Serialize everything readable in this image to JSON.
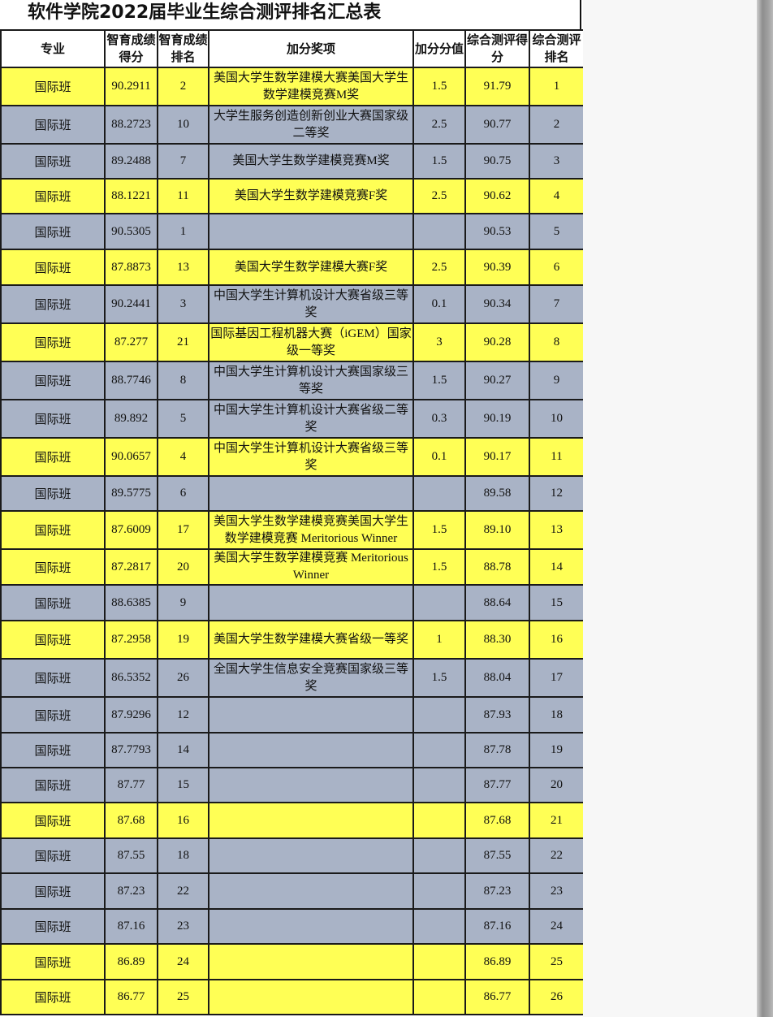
{
  "title": "软件学院2022届毕业生综合测评排名汇总表",
  "headers": {
    "major": "专业",
    "score": "智育成绩得分",
    "score_rank": "智育成绩排名",
    "award": "加分奖项",
    "bonus": "加分分值",
    "total": "综合测评得分",
    "total_rank": "综合测评排名"
  },
  "colors": {
    "yellow_row": "#ffff55",
    "gray_row": "#a9b3c6",
    "grid": "#1a1a1a"
  },
  "rows": [
    {
      "major": "国际班",
      "score": "90.2911",
      "score_rank": "2",
      "award": "美国大学生数学建模大赛美国大学生数学建模竞赛M奖",
      "bonus": "1.5",
      "total": "91.79",
      "total_rank": "1",
      "color": "yellow"
    },
    {
      "major": "国际班",
      "score": "88.2723",
      "score_rank": "10",
      "award": "大学生服务创造创新创业大赛国家级二等奖",
      "bonus": "2.5",
      "total": "90.77",
      "total_rank": "2",
      "color": "gray"
    },
    {
      "major": "国际班",
      "score": "89.2488",
      "score_rank": "7",
      "award": "美国大学生数学建模竞赛M奖",
      "bonus": "1.5",
      "total": "90.75",
      "total_rank": "3",
      "color": "gray"
    },
    {
      "major": "国际班",
      "score": "88.1221",
      "score_rank": "11",
      "award": "美国大学生数学建模竞赛F奖",
      "bonus": "2.5",
      "total": "90.62",
      "total_rank": "4",
      "color": "yellow"
    },
    {
      "major": "国际班",
      "score": "90.5305",
      "score_rank": "1",
      "award": "",
      "bonus": "",
      "total": "90.53",
      "total_rank": "5",
      "color": "gray"
    },
    {
      "major": "国际班",
      "score": "87.8873",
      "score_rank": "13",
      "award": "美国大学生数学建模大赛F奖",
      "bonus": "2.5",
      "total": "90.39",
      "total_rank": "6",
      "color": "yellow"
    },
    {
      "major": "国际班",
      "score": "90.2441",
      "score_rank": "3",
      "award": "中国大学生计算机设计大赛省级三等奖",
      "bonus": "0.1",
      "total": "90.34",
      "total_rank": "7",
      "color": "gray"
    },
    {
      "major": "国际班",
      "score": "87.277",
      "score_rank": "21",
      "award": "国际基因工程机器大赛（iGEM）国家级一等奖",
      "bonus": "3",
      "total": "90.28",
      "total_rank": "8",
      "color": "yellow"
    },
    {
      "major": "国际班",
      "score": "88.7746",
      "score_rank": "8",
      "award": "中国大学生计算机设计大赛国家级三等奖",
      "bonus": "1.5",
      "total": "90.27",
      "total_rank": "9",
      "color": "gray"
    },
    {
      "major": "国际班",
      "score": "89.892",
      "score_rank": "5",
      "award": "中国大学生计算机设计大赛省级二等奖",
      "bonus": "0.3",
      "total": "90.19",
      "total_rank": "10",
      "color": "gray"
    },
    {
      "major": "国际班",
      "score": "90.0657",
      "score_rank": "4",
      "award": "中国大学生计算机设计大赛省级三等奖",
      "bonus": "0.1",
      "total": "90.17",
      "total_rank": "11",
      "color": "yellow"
    },
    {
      "major": "国际班",
      "score": "89.5775",
      "score_rank": "6",
      "award": "",
      "bonus": "",
      "total": "89.58",
      "total_rank": "12",
      "color": "gray"
    },
    {
      "major": "国际班",
      "score": "87.6009",
      "score_rank": "17",
      "award": "美国大学生数学建模竞赛美国大学生数学建模竞赛 Meritorious Winner",
      "bonus": "1.5",
      "total": "89.10",
      "total_rank": "13",
      "color": "yellow"
    },
    {
      "major": "国际班",
      "score": "87.2817",
      "score_rank": "20",
      "award": "美国大学生数学建模竞赛 Meritorious Winner",
      "bonus": "1.5",
      "total": "88.78",
      "total_rank": "14",
      "color": "yellow"
    },
    {
      "major": "国际班",
      "score": "88.6385",
      "score_rank": "9",
      "award": "",
      "bonus": "",
      "total": "88.64",
      "total_rank": "15",
      "color": "gray"
    },
    {
      "major": "国际班",
      "score": "87.2958",
      "score_rank": "19",
      "award": "美国大学生数学建模大赛省级一等奖",
      "bonus": "1",
      "total": "88.30",
      "total_rank": "16",
      "color": "yellow"
    },
    {
      "major": "国际班",
      "score": "86.5352",
      "score_rank": "26",
      "award": "全国大学生信息安全竞赛国家级三等奖",
      "bonus": "1.5",
      "total": "88.04",
      "total_rank": "17",
      "color": "gray"
    },
    {
      "major": "国际班",
      "score": "87.9296",
      "score_rank": "12",
      "award": "",
      "bonus": "",
      "total": "87.93",
      "total_rank": "18",
      "color": "gray"
    },
    {
      "major": "国际班",
      "score": "87.7793",
      "score_rank": "14",
      "award": "",
      "bonus": "",
      "total": "87.78",
      "total_rank": "19",
      "color": "gray"
    },
    {
      "major": "国际班",
      "score": "87.77",
      "score_rank": "15",
      "award": "",
      "bonus": "",
      "total": "87.77",
      "total_rank": "20",
      "color": "gray"
    },
    {
      "major": "国际班",
      "score": "87.68",
      "score_rank": "16",
      "award": "",
      "bonus": "",
      "total": "87.68",
      "total_rank": "21",
      "color": "yellow"
    },
    {
      "major": "国际班",
      "score": "87.55",
      "score_rank": "18",
      "award": "",
      "bonus": "",
      "total": "87.55",
      "total_rank": "22",
      "color": "gray"
    },
    {
      "major": "国际班",
      "score": "87.23",
      "score_rank": "22",
      "award": "",
      "bonus": "",
      "total": "87.23",
      "total_rank": "23",
      "color": "gray"
    },
    {
      "major": "国际班",
      "score": "87.16",
      "score_rank": "23",
      "award": "",
      "bonus": "",
      "total": "87.16",
      "total_rank": "24",
      "color": "gray"
    },
    {
      "major": "国际班",
      "score": "86.89",
      "score_rank": "24",
      "award": "",
      "bonus": "",
      "total": "86.89",
      "total_rank": "25",
      "color": "yellow"
    },
    {
      "major": "国际班",
      "score": "86.77",
      "score_rank": "25",
      "award": "",
      "bonus": "",
      "total": "86.77",
      "total_rank": "26",
      "color": "yellow"
    }
  ]
}
